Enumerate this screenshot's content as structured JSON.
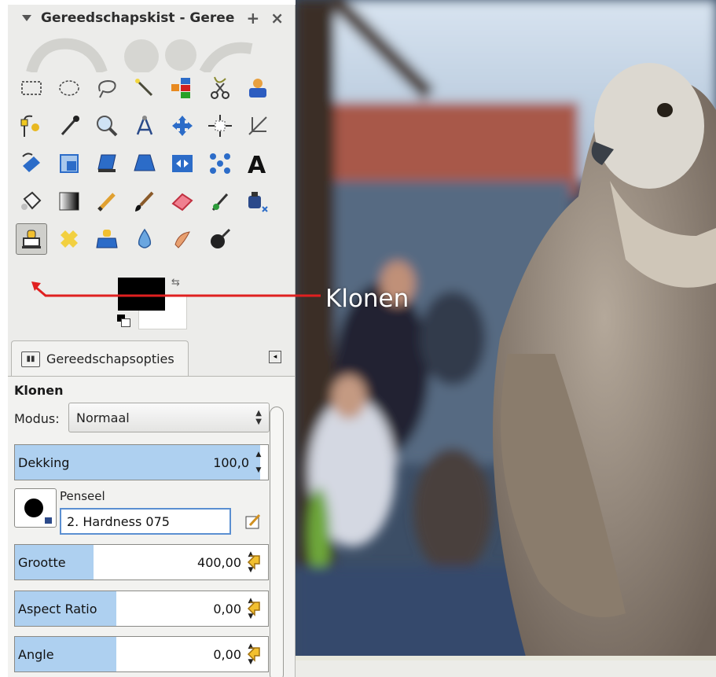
{
  "toolbox": {
    "title": "Gereedschapskist - Geree",
    "add_icon": "+",
    "close_icon": "×"
  },
  "tab": {
    "label": "Gereedschapsopties"
  },
  "options": {
    "tool_name": "Klonen",
    "mode_label": "Modus:",
    "mode_value": "Normaal",
    "opacity_label": "Dekking",
    "opacity_value": "100,0",
    "opacity_fraction": 0.97,
    "brush_label": "Penseel",
    "brush_value": "2. Hardness 075",
    "size_label": "Grootte",
    "size_value": "400,00",
    "size_fraction": 0.31,
    "aspect_label": "Aspect Ratio",
    "aspect_value": "0,00",
    "aspect_fraction": 0.4,
    "angle_label": "Angle",
    "angle_value": "0,00",
    "angle_fraction": 0.4
  },
  "colors": {
    "foreground": "#000000",
    "background": "#ffffff"
  },
  "annotation": {
    "text": "Klonen",
    "arrow_color": "#e02020"
  },
  "tools": [
    "rect-select-icon",
    "ellipse-select-icon",
    "lasso-icon",
    "fuzzy-select-icon",
    "color-select-icon",
    "scissors-select-icon",
    "foreground-select-icon",
    "paths-icon",
    "color-picker-icon",
    "zoom-icon",
    "measure-icon",
    "move-icon",
    "align-icon",
    "crop-icon",
    "rotate-icon",
    "scale-icon",
    "shear-icon",
    "perspective-icon",
    "flip-icon",
    "cage-icon",
    "text-icon",
    "bucket-fill-icon",
    "blend-icon",
    "pencil-icon",
    "paintbrush-icon",
    "eraser-icon",
    "airbrush-icon",
    "ink-icon",
    "clone-icon",
    "heal-icon",
    "perspective-clone-icon",
    "blur-icon",
    "smudge-icon",
    "dodge-burn-icon"
  ]
}
